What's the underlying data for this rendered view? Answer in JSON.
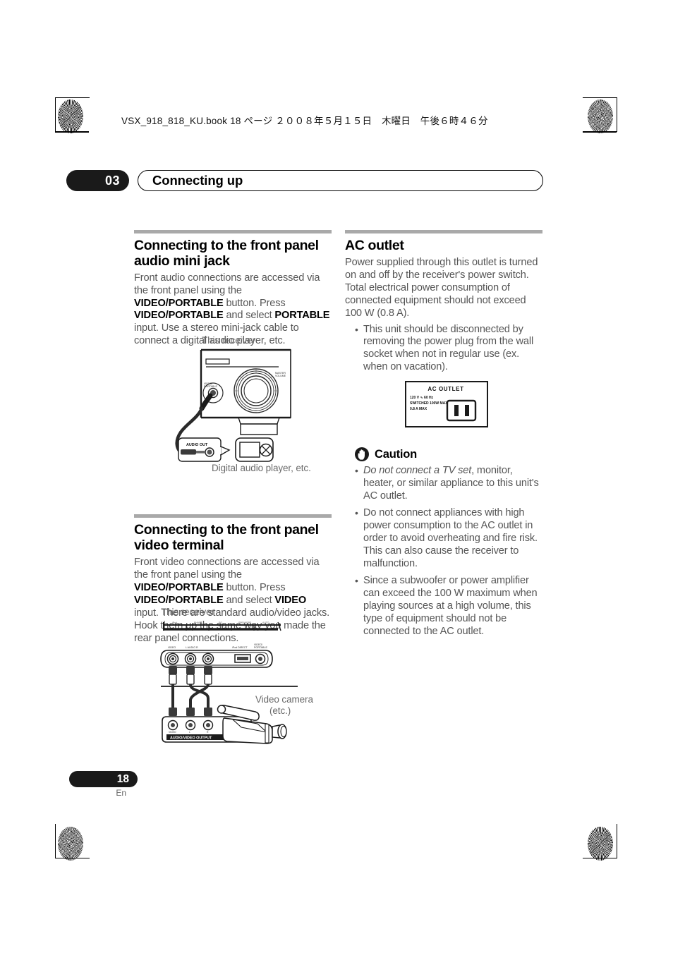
{
  "print_marks": {
    "file_header": "VSX_918_818_KU.book  18 ページ  ２００８年５月１５日　木曜日　午後６時４６分"
  },
  "chapter": {
    "number": "03",
    "title": "Connecting up"
  },
  "left_column": {
    "section1": {
      "heading": "Connecting to the front panel audio mini jack",
      "body_parts": [
        {
          "t": "Front audio connections are accessed via the front panel using the ",
          "b": false
        },
        {
          "t": "VIDEO/PORTABLE",
          "b": true
        },
        {
          "t": " button. Press ",
          "b": false
        },
        {
          "t": "VIDEO/PORTABLE",
          "b": true
        },
        {
          "t": " and select ",
          "b": false
        },
        {
          "t": "PORTABLE",
          "b": true
        },
        {
          "t": " input. Use a stereo mini-jack cable to connect a digital audio player, etc.",
          "b": false
        }
      ],
      "figure": {
        "caption_top": "This receiver",
        "caption_bottom": "Digital audio player, etc.",
        "callout_label": "AUDIO OUT",
        "receiver_jack_label": "VIDEO/PORTABLE",
        "receiver_knob_label": "MASTER VOLUME"
      }
    },
    "section2": {
      "heading": "Connecting to the front panel video terminal",
      "body_parts": [
        {
          "t": "Front video connections are accessed via the front panel using the ",
          "b": false
        },
        {
          "t": "VIDEO/PORTABLE",
          "b": true
        },
        {
          "t": " button. Press ",
          "b": false
        },
        {
          "t": "VIDEO/PORTABLE",
          "b": true
        },
        {
          "t": " and select ",
          "b": false
        },
        {
          "t": "VIDEO",
          "b": true
        },
        {
          "t": " input. There are standard audio/video jacks. Hook them up the same way you made the rear panel connections.",
          "b": false
        }
      ],
      "figure": {
        "caption_top": "This receiver",
        "caption_right_line1": "Video camera",
        "caption_right_line2": "(etc.)",
        "jack_labels": [
          "VIDEO",
          "L  AUDIO  R",
          "iPod DIRECT",
          "VIDEO/ PORTABLE"
        ],
        "callout_label": "AUDIO/VIDEO OUTPUT",
        "callout_jack_labels": [
          "VIDEO",
          "L",
          "R"
        ]
      }
    }
  },
  "right_column": {
    "section1": {
      "heading": "AC outlet",
      "body": "Power supplied through this outlet is turned on and off by the receiver's power switch. Total electrical power consumption of connected equipment should not exceed 100 W (0.8 A).",
      "bullets": [
        "This unit should be disconnected by removing the power plug from the wall socket when not in regular use (ex. when on vacation)."
      ],
      "figure": {
        "title": "AC OUTLET",
        "spec_line1": "120 V ∿ 60 Hz",
        "spec_line2": "SWITCHED 100W MAX",
        "spec_line3": "0.8 A MAX"
      }
    },
    "caution": {
      "title": "Caution",
      "icon": "stop-hand-icon",
      "bullets": [
        {
          "italic_lead": "Do not connect a TV set",
          "rest": ", monitor, heater, or similar appliance to this unit's AC outlet."
        },
        {
          "italic_lead": "",
          "rest": "Do not connect appliances with high power consumption to the AC outlet in order to avoid overheating and fire risk. This can also cause the receiver to malfunction."
        },
        {
          "italic_lead": "",
          "rest": "Since a subwoofer or power amplifier can exceed the 100 W maximum when playing sources at a high volume, this type of equipment should not be connected to the AC outlet."
        }
      ]
    }
  },
  "footer": {
    "page_number": "18",
    "language": "En"
  },
  "colors": {
    "rule_gray": "#a9a9a9",
    "body_text": "#555555",
    "pill_black": "#1a1a1a",
    "caption_gray": "#6a6a6a"
  }
}
